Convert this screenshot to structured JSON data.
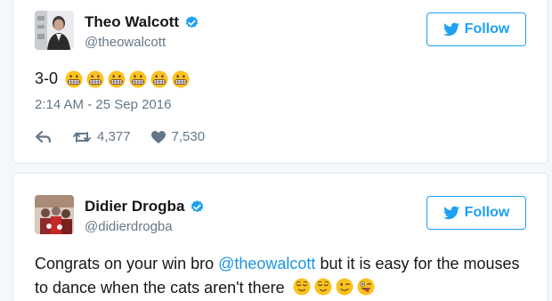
{
  "tweets": [
    {
      "author": {
        "name": "Theo Walcott",
        "handle": "@theowalcott",
        "verified": true
      },
      "follow_label": "Follow",
      "text": "3-0",
      "emoji_names": [
        "grimacing-face",
        "grimacing-face",
        "grimacing-face",
        "grimacing-face",
        "grimacing-face",
        "grimacing-face"
      ],
      "timestamp": "2:14 AM - 25 Sep 2016",
      "retweets": "4,377",
      "likes": "7,530"
    },
    {
      "author": {
        "name": "Didier Drogba",
        "handle": "@didierdrogba",
        "verified": true
      },
      "follow_label": "Follow",
      "text_before": "Congrats on your win bro ",
      "mention": "@theowalcott",
      "text_after": " but it is easy for the mouses to dance when the cats aren't there",
      "emoji_names": [
        "relieved-face",
        "relieved-face",
        "winking-face",
        "winking-face-with-tongue"
      ]
    }
  ],
  "colors": {
    "brand_blue": "#1da1f2",
    "link_blue": "#1b95e0",
    "secondary_text": "#657786",
    "border": "#e1e8ed",
    "background": "#f5f8fa"
  },
  "icons": {
    "verified": "verified-badge-icon",
    "follow": "twitter-bird-icon",
    "reply": "reply-icon",
    "retweet": "retweet-icon",
    "like": "heart-icon"
  }
}
